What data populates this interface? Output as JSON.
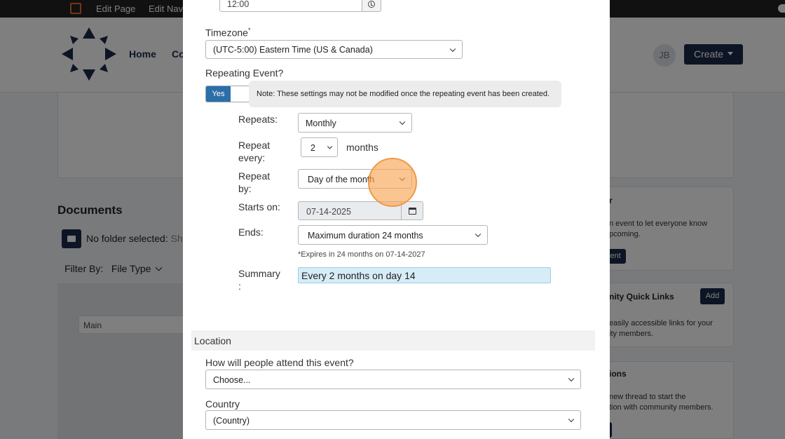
{
  "background": {
    "topbar": {
      "edit_page": "Edit Page",
      "edit_nav": "Edit Navi"
    },
    "header": {
      "nav_home": "Home",
      "nav_co": "Co",
      "avatar_initials": "JB",
      "create_label": "Create"
    },
    "documents": {
      "title": "Documents",
      "no_folder": "No folder selected:",
      "no_folder_suffix": "Sh",
      "filter_label": "Filter By:",
      "file_type": "File Type",
      "main_cell": "Main"
    },
    "sidebar": {
      "card1_title": "r",
      "card1_text": "n event to let everyone know\npcoming.",
      "card1_button": "ent",
      "card2_title": "nity Quick Links",
      "card2_add": "Add",
      "card2_text": "easily accessible links for your\nity members.",
      "card3_title": "ions",
      "card3_text": "new thread to start the\ntion with community members."
    }
  },
  "modal": {
    "time_value": "12:00",
    "timezone_label": "Timezone",
    "timezone_value": "(UTC-5:00) Eastern Time (US & Canada)",
    "repeating_label": "Repeating Event?",
    "toggle_yes": "Yes",
    "note_text": "Note: These settings may not be modified once the repeating event has been created.",
    "repeats_label": "Repeats:",
    "repeats_value": "Monthly",
    "repeat_every_label": "Repeat every:",
    "repeat_every_value": "2",
    "repeat_every_unit": "months",
    "repeat_by_label": "Repeat by:",
    "repeat_by_value": "Day of the month",
    "starts_on_label": "Starts on:",
    "starts_on_value": "07-14-2025",
    "ends_label": "Ends:",
    "ends_value": "Maximum duration 24 months",
    "expires_text": "*Expires in 24 months on 07-14-2027",
    "summary_label": "Summary :",
    "summary_value": "Every 2 months on day 14",
    "location_section": "Location",
    "attend_label": "How will people attend this event?",
    "attend_value": "Choose...",
    "country_label": "Country",
    "country_value": "(Country)"
  },
  "colors": {
    "brand": "#1b2a4a",
    "toggle_on": "#2c6ea8",
    "summary_bg": "#d6ecf7",
    "click_marker": "#f7a654"
  }
}
